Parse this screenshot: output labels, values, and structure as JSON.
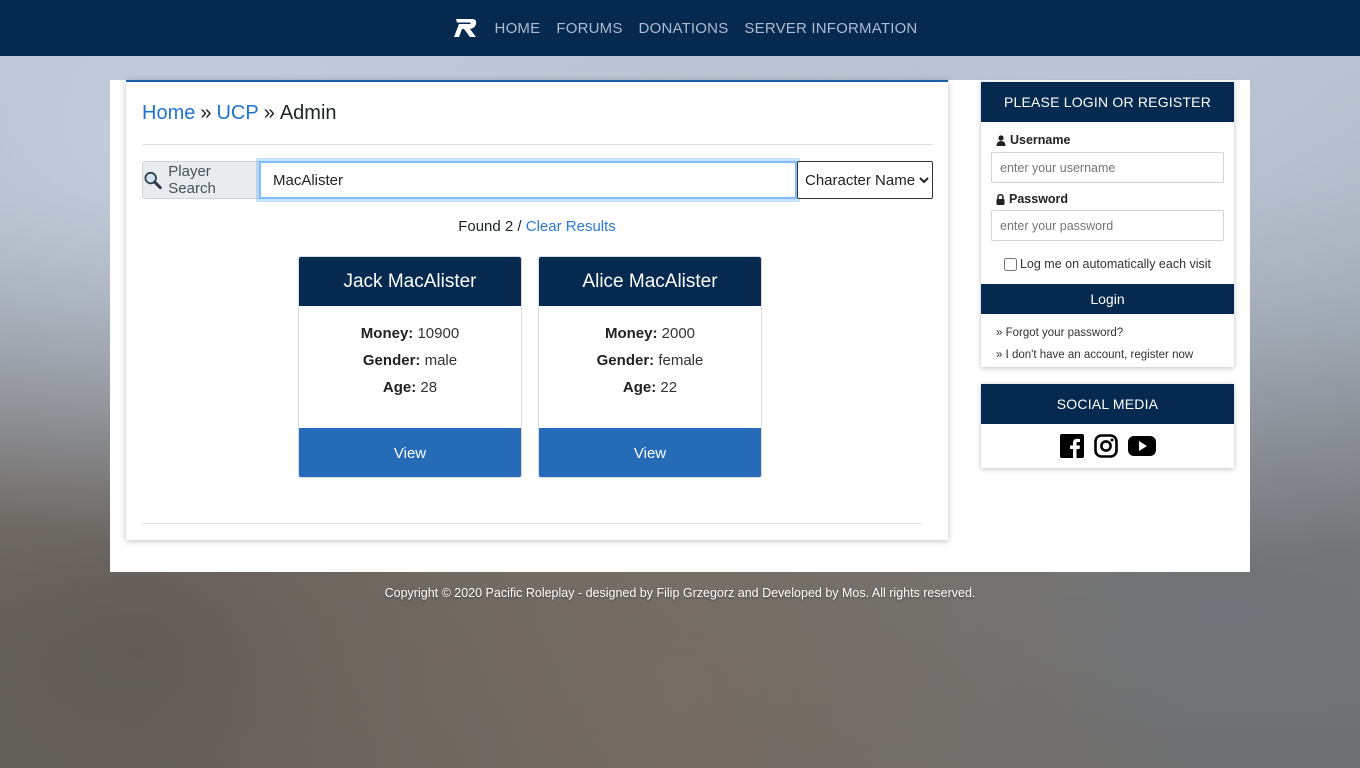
{
  "nav": {
    "logo": "R-logo-icon",
    "links": [
      "HOME",
      "FORUMS",
      "DONATIONS",
      "SERVER INFORMATION"
    ]
  },
  "breadcrumb": {
    "items": [
      "Home",
      "UCP",
      "Admin"
    ],
    "separator": "»"
  },
  "search": {
    "addon_label": "Player Search",
    "addon_icon": "magnifier-icon",
    "value": "MacAlister",
    "select_selected": "Character Name"
  },
  "results": {
    "found_text": "Found 2 /",
    "clear_label": "Clear Results",
    "cards": [
      {
        "name": "Jack MacAlister",
        "money_label": "Money:",
        "money": "10900",
        "gender_label": "Gender:",
        "gender": "male",
        "age_label": "Age:",
        "age": "28",
        "button": "View"
      },
      {
        "name": "Alice MacAlister",
        "money_label": "Money:",
        "money": "2000",
        "gender_label": "Gender:",
        "gender": "female",
        "age_label": "Age:",
        "age": "22",
        "button": "View"
      }
    ]
  },
  "login": {
    "title": "PLEASE LOGIN OR REGISTER",
    "username_label": "Username",
    "username_placeholder": "enter your username",
    "password_label": "Password",
    "password_placeholder": "enter your password",
    "remember_label": "Log me on automatically each visit",
    "button": "Login",
    "forgot_link": "» Forgot your password?",
    "register_link": "» I don't have an account, register now"
  },
  "social": {
    "title": "SOCIAL MEDIA",
    "icons": [
      "facebook-icon",
      "instagram-icon",
      "youtube-icon"
    ]
  },
  "footer": {
    "text": "Copyright © 2020 Pacific Roleplay - designed by Filip Grzegorz and Developed by Mos. All rights reserved."
  },
  "colors": {
    "navy": "#05294f",
    "link_blue": "#1f74d3",
    "button_blue": "#256bb8"
  }
}
